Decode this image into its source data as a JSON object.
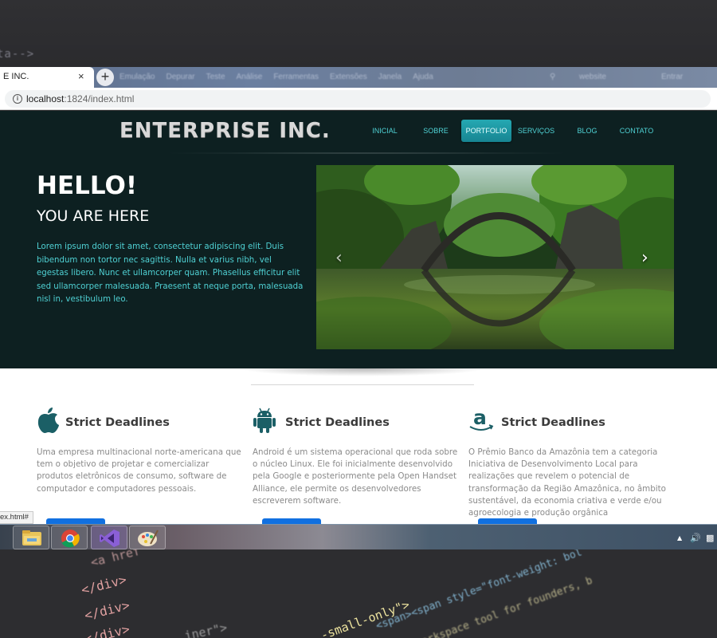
{
  "backdrop": {
    "top_code": "ta-->",
    "bottom_code": [
      "<a href",
      "</div>",
      "</div>",
      "</div>",
      "-small-only\">",
      "<span><span style=\"font-weight: bol",
      "workspace tool for founders, b",
      "iner\">"
    ]
  },
  "browser": {
    "tab_title": "E INC.",
    "tab_close": "×",
    "new_tab": "+",
    "menu_items": [
      "Emulação",
      "Depurar",
      "Teste",
      "Análise",
      "Ferramentas",
      "Extensões",
      "Janela",
      "Ajuda"
    ],
    "right_items": [
      "website",
      "Entrar"
    ],
    "url_host": "localhost",
    "url_path": ":1824/index.html",
    "status_url": "ex.html#"
  },
  "page": {
    "brand": "ENTERPRISE INC.",
    "nav": [
      {
        "label": "INICIAL",
        "active": false
      },
      {
        "label": "SOBRE",
        "active": false
      },
      {
        "label": "PORTFOLIO",
        "active": true
      },
      {
        "label": "SERVIÇOS",
        "active": false
      },
      {
        "label": "BLOG",
        "active": false
      },
      {
        "label": "CONTATO",
        "active": false
      }
    ],
    "hero": {
      "heading": "HELLO!",
      "subheading": "YOU ARE HERE",
      "body": "Lorem ipsum dolor sit amet, consectetur adipiscing elit. Duis bibendum non tortor nec sagittis. Nulla et varius nibh, vel egestas libero. Nunc et ullamcorper quam. Phasellus efficitur elit sed ullamcorper malesuada. Praesent at neque porta, malesuada nisl in, vestibulum leo.",
      "carousel_prev": "‹",
      "carousel_next": "›"
    },
    "features": [
      {
        "icon": "apple-icon",
        "title": "Strict Deadlines",
        "text": "Uma empresa multinacional norte-americana que tem o objetivo de projetar e comercializar produtos eletrônicos de consumo, software de computador e computadores pessoais."
      },
      {
        "icon": "android-icon",
        "title": "Strict Deadlines",
        "text": "Android é um sistema operacional que roda sobre o núcleo Linux. Ele foi inicialmente desenvolvido pela Google e posteriormente pela Open Handset Alliance, ele permite os desenvolvedores escreverem software."
      },
      {
        "icon": "amazon-icon",
        "title": "Strict Deadlines",
        "text": "O Prêmio Banco da Amazônia tem a categoria Iniciativa de Desenvolvimento Local para realizações que revelem o potencial de transformação da Região Amazônica, no âmbito sustentável, da economia criativa e verde e/ou agroecologia e produção orgânica"
      }
    ]
  },
  "taskbar": {
    "apps": [
      "file-explorer-icon",
      "chrome-icon",
      "visual-studio-icon",
      "paint-icon"
    ],
    "tray": [
      "▲",
      "🔊"
    ]
  },
  "colors": {
    "hero_bg": "#0d2021",
    "accent": "#4fd1d4",
    "nav_active": "#1c96a2",
    "icon_teal": "#1b5f66",
    "button_blue": "#1170e0"
  }
}
